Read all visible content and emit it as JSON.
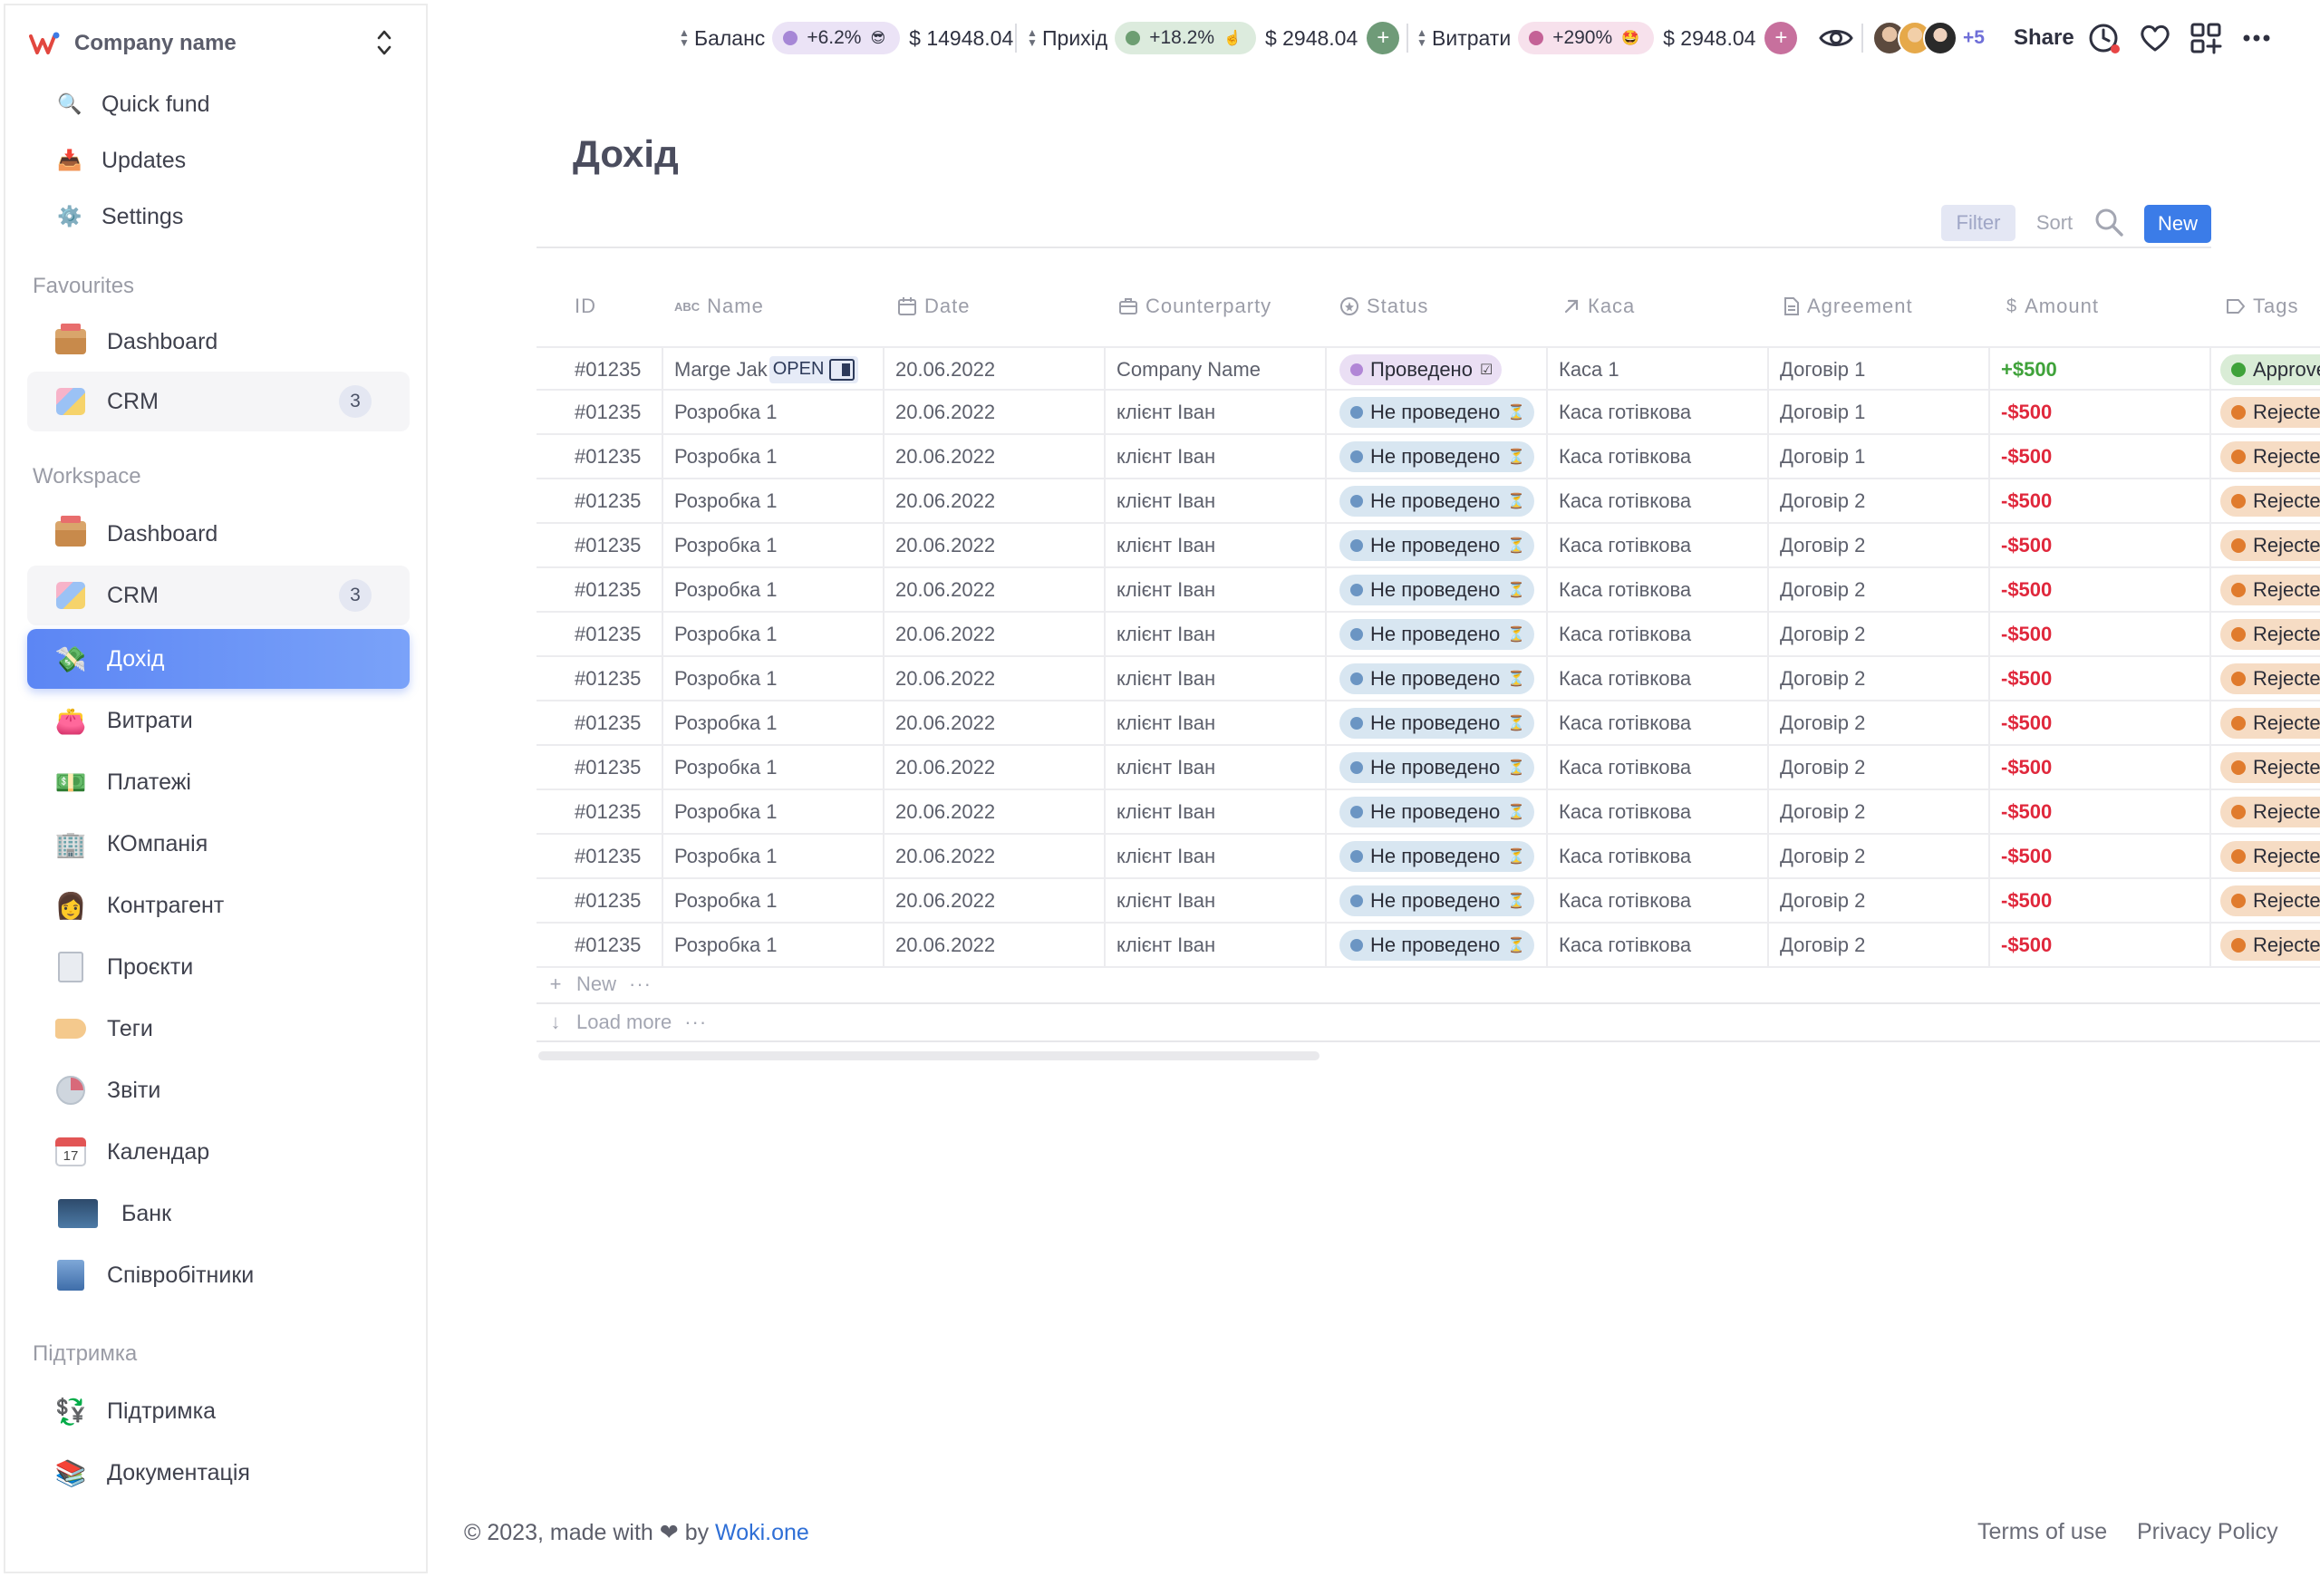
{
  "company": {
    "name": "Company name"
  },
  "sidebar": {
    "top_items": [
      {
        "label": "Quick fund",
        "icon": "search-icon"
      },
      {
        "label": "Updates",
        "icon": "inbox-tray-icon"
      },
      {
        "label": "Settings",
        "icon": "gear-icon"
      }
    ],
    "favourites_title": "Favourites",
    "favourites": [
      {
        "label": "Dashboard",
        "icon": "box-icon"
      },
      {
        "label": "CRM",
        "icon": "crm-icon",
        "count": "3"
      }
    ],
    "workspace_title": "Workspace",
    "workspace": [
      {
        "label": "Dashboard",
        "icon": "box-icon"
      },
      {
        "label": "CRM",
        "icon": "crm-icon",
        "count": "3"
      },
      {
        "label": "Дохід",
        "icon": "money-hand-icon",
        "active": true
      },
      {
        "label": "Витрати",
        "icon": "wallet-icon"
      },
      {
        "label": "Платежі",
        "icon": "dollar-banknote-icon"
      },
      {
        "label": "КОмпанія",
        "icon": "office-building-icon"
      },
      {
        "label": "Контрагент",
        "icon": "person-icon"
      },
      {
        "label": "Проєкти",
        "icon": "document-icon"
      },
      {
        "label": "Теги",
        "icon": "tag-icon"
      },
      {
        "label": "Звіти",
        "icon": "disk-chart-icon"
      },
      {
        "label": "Календар",
        "icon": "calendar-icon",
        "day": "17"
      },
      {
        "label": "Банк",
        "icon": "bank-icon"
      },
      {
        "label": "Співробітники",
        "icon": "employee-icon"
      }
    ],
    "support_title": "Підтримка",
    "support": [
      {
        "label": "Підтримка",
        "icon": "support-icon"
      },
      {
        "label": "Документація",
        "icon": "documentation-icon"
      }
    ]
  },
  "topbar": {
    "metrics": [
      {
        "label": "Баланс",
        "change": "+6.2%",
        "emoji": "😎",
        "amount": "$ 14948.04",
        "dot_color": "#a687d6",
        "pill_color": "#ebe3f6"
      },
      {
        "label": "Прихід",
        "change": "+18.2%",
        "emoji": "☝️",
        "amount": "$ 2948.04",
        "dot_color": "#6d9e72",
        "pill_color": "#dcebdd",
        "button_color": "#6f9b78"
      },
      {
        "label": "Витрати",
        "change": "+290%",
        "emoji": "🤩",
        "amount": "$ 2948.04",
        "dot_color": "#c46296",
        "pill_color": "#f7e1ec",
        "button_color": "#c7709d"
      }
    ],
    "avatars_more": "+5",
    "share_label": "Share"
  },
  "page": {
    "title": "Дохід",
    "filter_label": "Filter",
    "sort_label": "Sort",
    "new_label": "New"
  },
  "table": {
    "columns": [
      {
        "label": "ID",
        "icon": ""
      },
      {
        "label": "Name",
        "icon": "text-type-icon"
      },
      {
        "label": "Date",
        "icon": "calendar-outline-icon"
      },
      {
        "label": "Counterparty",
        "icon": "briefcase-icon"
      },
      {
        "label": "Status",
        "icon": "status-circle-icon"
      },
      {
        "label": "Каса",
        "icon": "arrow-up-right-icon"
      },
      {
        "label": "Agreement",
        "icon": "document-outline-icon"
      },
      {
        "label": "Amount",
        "icon": "dollar-icon"
      },
      {
        "label": "Tags",
        "icon": "tag-outline-icon"
      }
    ],
    "open_label": "OPEN",
    "rows": [
      {
        "id": "#01235",
        "name": "Marge Jak",
        "date": "20.06.2022",
        "counterparty": "Company Name",
        "status": "Проведено",
        "kasa": "Каса 1",
        "agreement": "Договір 1",
        "amount": "+$500",
        "tag": "Approved"
      },
      {
        "id": "#01235",
        "name": "Розробка 1",
        "date": "20.06.2022",
        "counterparty": "клієнт Іван",
        "status": "Не проведено",
        "kasa": "Каса готівкова",
        "agreement": "Договір 1",
        "amount": "-$500",
        "tag": "Rejected"
      },
      {
        "id": "#01235",
        "name": "Розробка 1",
        "date": "20.06.2022",
        "counterparty": "клієнт Іван",
        "status": "Не проведено",
        "kasa": "Каса готівкова",
        "agreement": "Договір 1",
        "amount": "-$500",
        "tag": "Rejected"
      },
      {
        "id": "#01235",
        "name": "Розробка 1",
        "date": "20.06.2022",
        "counterparty": "клієнт Іван",
        "status": "Не проведено",
        "kasa": "Каса готівкова",
        "agreement": "Договір 2",
        "amount": "-$500",
        "tag": "Rejected"
      },
      {
        "id": "#01235",
        "name": "Розробка 1",
        "date": "20.06.2022",
        "counterparty": "клієнт Іван",
        "status": "Не проведено",
        "kasa": "Каса готівкова",
        "agreement": "Договір 2",
        "amount": "-$500",
        "tag": "Rejected"
      },
      {
        "id": "#01235",
        "name": "Розробка 1",
        "date": "20.06.2022",
        "counterparty": "клієнт Іван",
        "status": "Не проведено",
        "kasa": "Каса готівкова",
        "agreement": "Договір 2",
        "amount": "-$500",
        "tag": "Rejected"
      },
      {
        "id": "#01235",
        "name": "Розробка 1",
        "date": "20.06.2022",
        "counterparty": "клієнт Іван",
        "status": "Не проведено",
        "kasa": "Каса готівкова",
        "agreement": "Договір 2",
        "amount": "-$500",
        "tag": "Rejected"
      },
      {
        "id": "#01235",
        "name": "Розробка 1",
        "date": "20.06.2022",
        "counterparty": "клієнт Іван",
        "status": "Не проведено",
        "kasa": "Каса готівкова",
        "agreement": "Договір 2",
        "amount": "-$500",
        "tag": "Rejected"
      },
      {
        "id": "#01235",
        "name": "Розробка 1",
        "date": "20.06.2022",
        "counterparty": "клієнт Іван",
        "status": "Не проведено",
        "kasa": "Каса готівкова",
        "agreement": "Договір 2",
        "amount": "-$500",
        "tag": "Rejected"
      },
      {
        "id": "#01235",
        "name": "Розробка 1",
        "date": "20.06.2022",
        "counterparty": "клієнт Іван",
        "status": "Не проведено",
        "kasa": "Каса готівкова",
        "agreement": "Договір 2",
        "amount": "-$500",
        "tag": "Rejected"
      },
      {
        "id": "#01235",
        "name": "Розробка 1",
        "date": "20.06.2022",
        "counterparty": "клієнт Іван",
        "status": "Не проведено",
        "kasa": "Каса готівкова",
        "agreement": "Договір 2",
        "amount": "-$500",
        "tag": "Rejected"
      },
      {
        "id": "#01235",
        "name": "Розробка 1",
        "date": "20.06.2022",
        "counterparty": "клієнт Іван",
        "status": "Не проведено",
        "kasa": "Каса готівкова",
        "agreement": "Договір 2",
        "amount": "-$500",
        "tag": "Rejected"
      },
      {
        "id": "#01235",
        "name": "Розробка 1",
        "date": "20.06.2022",
        "counterparty": "клієнт Іван",
        "status": "Не проведено",
        "kasa": "Каса готівкова",
        "agreement": "Договір 2",
        "amount": "-$500",
        "tag": "Rejected"
      },
      {
        "id": "#01235",
        "name": "Розробка 1",
        "date": "20.06.2022",
        "counterparty": "клієнт Іван",
        "status": "Не проведено",
        "kasa": "Каса готівкова",
        "agreement": "Договір 2",
        "amount": "-$500",
        "tag": "Rejected"
      }
    ],
    "new_row_label": "New",
    "load_more_label": "Load more"
  },
  "footer": {
    "copyright_prefix": "© 2023, made with",
    "by": "by",
    "brand": "Woki.one",
    "terms": "Terms of use",
    "privacy": "Privacy Policy"
  }
}
